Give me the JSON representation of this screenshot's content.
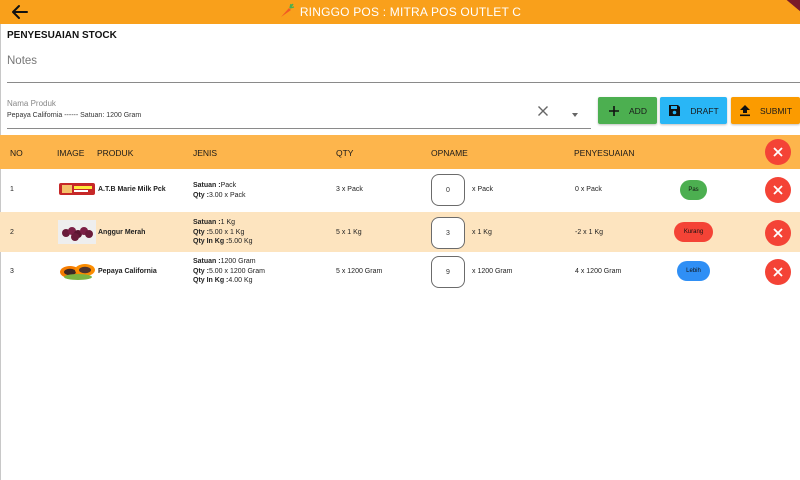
{
  "appbar": {
    "title": "RINGGO POS : MITRA POS OUTLET C",
    "bg_color": "#f9a01b"
  },
  "page": {
    "title": "PENYESUAIAN STOCK"
  },
  "notes": {
    "label": "Notes"
  },
  "product_select": {
    "label": "Nama Produk",
    "value": "Pepaya California ------ Satuan: 1200 Gram"
  },
  "buttons": {
    "add": "ADD",
    "draft": "DRAFT",
    "submit": "SUBMIT"
  },
  "table": {
    "headers": {
      "no": "NO",
      "image": "IMAGE",
      "produk": "PRODUK",
      "jenis": "JENIS",
      "qty": "QTY",
      "opname": "OPNAME",
      "penyesuaian": "PENYESUAIAN"
    },
    "rows": [
      {
        "no": "1",
        "produk": "A.T.B Marie Milk Pck",
        "satuan_label": "Satuan :",
        "satuan": "Pack",
        "qty_label": "Qty :",
        "qty_detail": "3.00 x Pack",
        "qty_in_kg_label": "",
        "qty_in_kg": "",
        "qty": "3 x Pack",
        "opname": "0",
        "opname_unit": "x Pack",
        "penyesuaian": "0 x Pack",
        "status": "Pas",
        "status_color": "#4caf50"
      },
      {
        "no": "2",
        "produk": "Anggur Merah",
        "satuan_label": "Satuan :",
        "satuan": "1 Kg",
        "qty_label": "Qty :",
        "qty_detail": "5.00 x 1 Kg",
        "qty_in_kg_label": "Qty In Kg :",
        "qty_in_kg": "5.00 Kg",
        "qty": "5 x 1 Kg",
        "opname": "3",
        "opname_unit": "x 1 Kg",
        "penyesuaian": "-2 x 1 Kg",
        "status": "Kurang",
        "status_color": "#f44336"
      },
      {
        "no": "3",
        "produk": "Pepaya California",
        "satuan_label": "Satuan :",
        "satuan": "1200 Gram",
        "qty_label": "Qty :",
        "qty_detail": "5.00 x 1200 Gram",
        "qty_in_kg_label": "Qty In Kg :",
        "qty_in_kg": "4.00 Kg",
        "qty": "5 x 1200 Gram",
        "opname": "9",
        "opname_unit": "x 1200 Gram",
        "penyesuaian": "4 x 1200 Gram",
        "status": "Lebih",
        "status_color": "#2f8ff5"
      }
    ]
  }
}
